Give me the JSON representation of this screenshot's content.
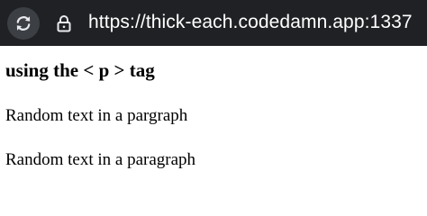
{
  "browser": {
    "url": "https://thick-each.codedamn.app:1337"
  },
  "page": {
    "heading": "using the < p > tag",
    "paragraphs": [
      "Random text in a pargraph",
      "Random text in a paragraph"
    ]
  },
  "colors": {
    "toolbar_bg": "#202124",
    "button_bg": "#3c3f43",
    "icon_color": "#e8eaed",
    "url_color": "#ffffff",
    "page_bg": "#ffffff",
    "text_color": "#000000"
  },
  "icons": {
    "reload": "reload-icon",
    "lock": "lock-icon"
  }
}
